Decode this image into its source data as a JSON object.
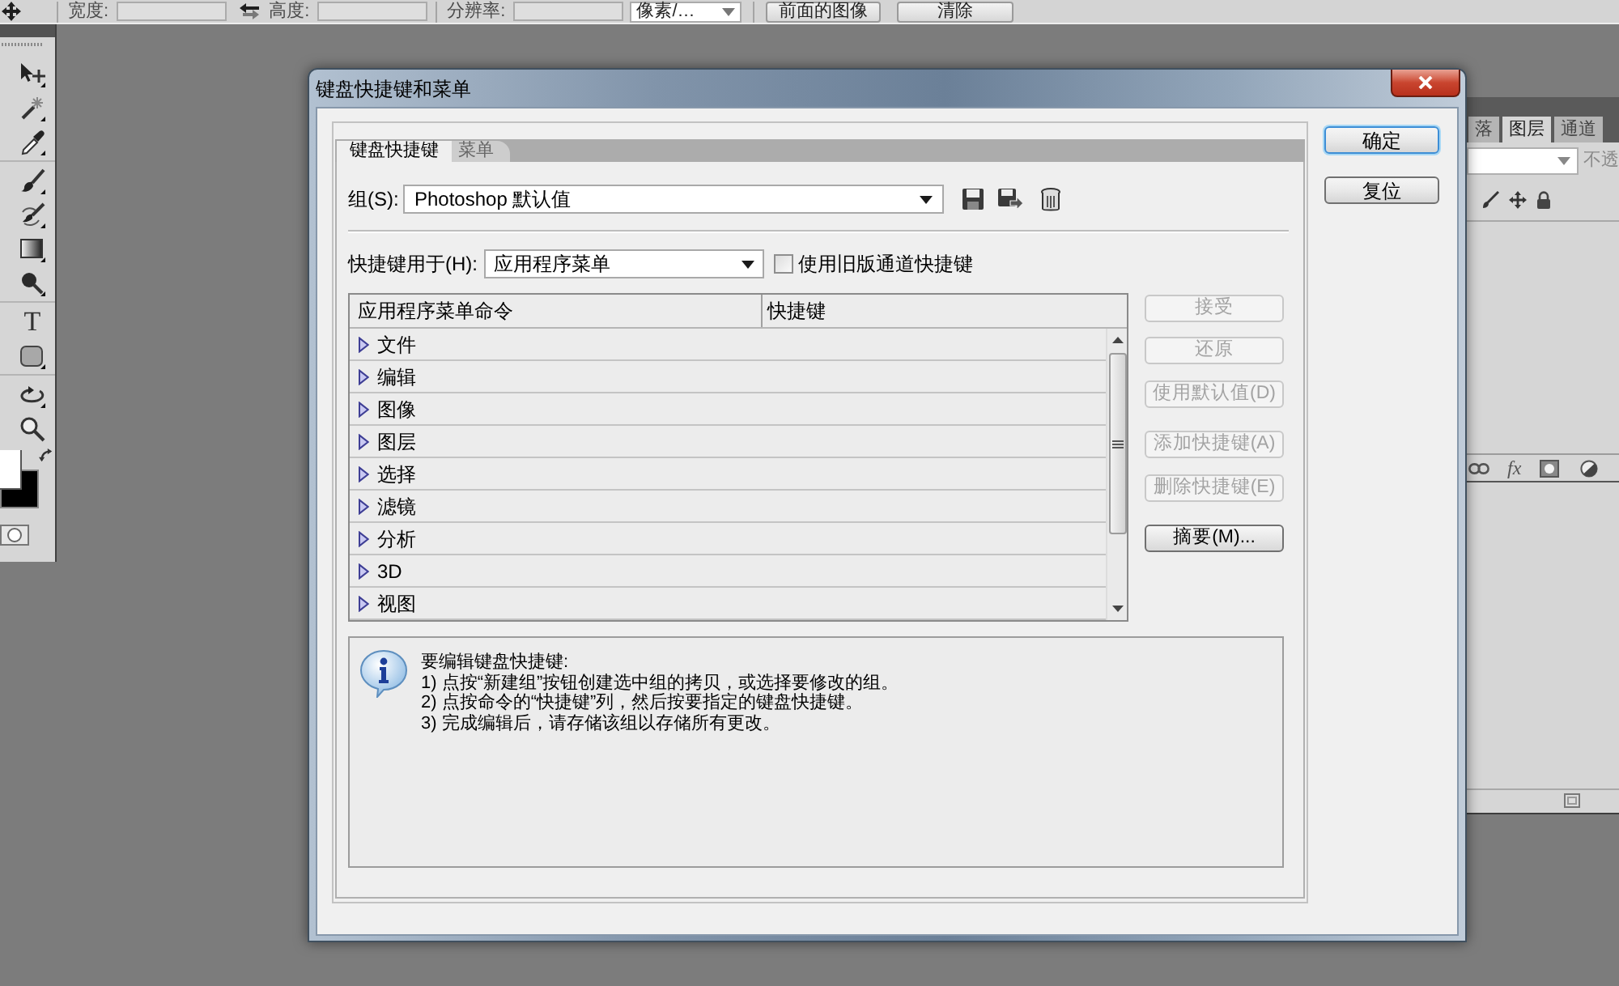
{
  "options_bar": {
    "fields": [
      {
        "label": "宽度:"
      },
      {
        "label": "高度:"
      },
      {
        "label": "分辨率:"
      }
    ],
    "unit_select": "像素/…",
    "buttons": [
      "前面的图像",
      "清除"
    ]
  },
  "toolbox": {
    "type_glyph": "T",
    "colors": [
      {
        "kind": "foreground",
        "color": "#ffffff"
      },
      {
        "kind": "background",
        "color": "#000000"
      }
    ]
  },
  "dialog": {
    "title": "键盘快捷键和菜单",
    "tabs": [
      {
        "label": "键盘快捷键",
        "selected": true
      },
      {
        "label": "菜单",
        "selected": false
      }
    ],
    "group": {
      "label": "组(S):",
      "value": "Photoshop 默认值"
    },
    "shortcuts_for": {
      "label": "快捷键用于(H):",
      "value": "应用程序菜单"
    },
    "legacy_channels": {
      "label": "使用旧版通道快捷键",
      "checked": false
    },
    "table": {
      "columns": [
        "应用程序菜单命令",
        "快捷键"
      ],
      "rows": [
        {
          "command": "文件",
          "expanded": false
        },
        {
          "command": "编辑",
          "expanded": false
        },
        {
          "command": "图像",
          "expanded": false
        },
        {
          "command": "图层",
          "expanded": false
        },
        {
          "command": "选择",
          "expanded": false
        },
        {
          "command": "滤镜",
          "expanded": false
        },
        {
          "command": "分析",
          "expanded": false
        },
        {
          "command": "3D",
          "expanded": false
        },
        {
          "command": "视图",
          "expanded": false
        }
      ]
    },
    "side_buttons": [
      {
        "label": "接受",
        "disabled": true
      },
      {
        "label": "还原",
        "disabled": true
      },
      {
        "label": "使用默认值(D)",
        "disabled": true
      },
      {
        "label": "添加快捷键(A)",
        "disabled": true
      },
      {
        "label": "删除快捷键(E)",
        "disabled": true
      },
      {
        "label": "摘要(M)...",
        "disabled": false
      }
    ],
    "info": {
      "heading": "要编辑键盘快捷键:",
      "lines": [
        "1) 点按“新建组”按钮创建选中组的拷贝，或选择要修改的组。",
        "2) 点按命令的“快捷键”列，然后按要指定的键盘快捷键。",
        "3) 完成编辑后，请存储该组以存储所有更改。"
      ]
    },
    "buttons": [
      {
        "label": "确定",
        "default": true
      },
      {
        "label": "复位",
        "default": false
      }
    ]
  },
  "layers_panel": {
    "tabs": [
      {
        "label": "落",
        "selected": false
      },
      {
        "label": "图层",
        "selected": true
      },
      {
        "label": "通道",
        "selected": false
      }
    ],
    "opacity_label": "不透",
    "effects_glyph": "fx"
  }
}
